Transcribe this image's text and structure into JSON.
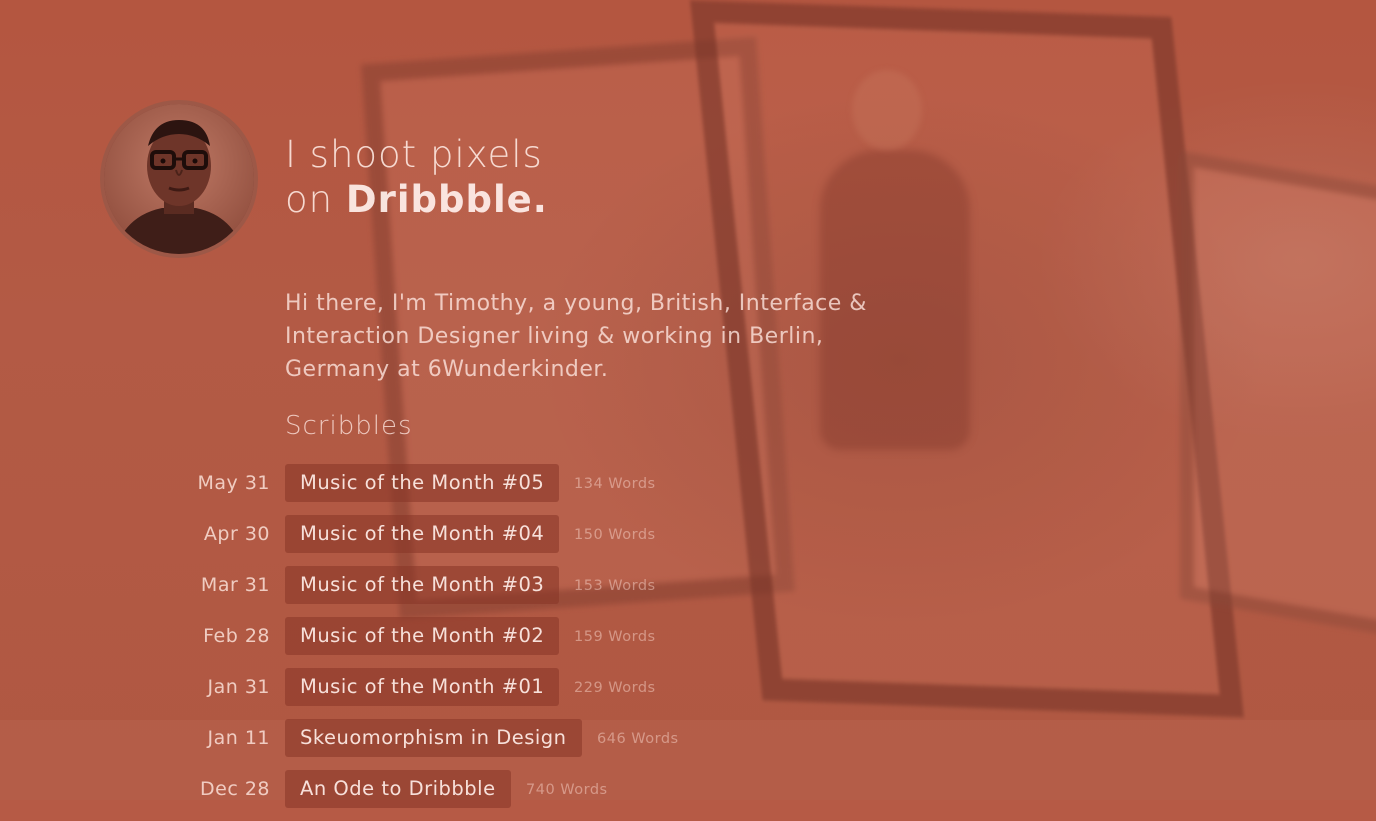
{
  "header": {
    "line1": "I shoot pixels",
    "line2_prefix": "on ",
    "line2_brand": "Dribbble."
  },
  "intro": {
    "text": "Hi there, I'm Timothy, a young, British, Interface & Interaction Designer living & working in Berlin, Germany at 6Wunderkinder."
  },
  "scribbles": {
    "title": "Scribbles",
    "posts": [
      {
        "date": "May 31",
        "title": "Music of the Month #05",
        "words": "134 Words"
      },
      {
        "date": "Apr 30",
        "title": "Music of the Month #04",
        "words": "150 Words"
      },
      {
        "date": "Mar 31",
        "title": "Music of the Month #03",
        "words": "153 Words"
      },
      {
        "date": "Feb 28",
        "title": "Music of the Month #02",
        "words": "159 Words"
      },
      {
        "date": "Jan 31",
        "title": "Music of the Month #01",
        "words": "229 Words"
      },
      {
        "date": "Jan 11",
        "title": "Skeuomorphism in Design",
        "words": "646 Words"
      },
      {
        "date": "Dec 28",
        "title": "An Ode to Dribbble",
        "words": "740 Words"
      }
    ]
  },
  "colors": {
    "overlay": "#b65a45",
    "button_bg": "#87342680",
    "text": "#ffebe4"
  }
}
